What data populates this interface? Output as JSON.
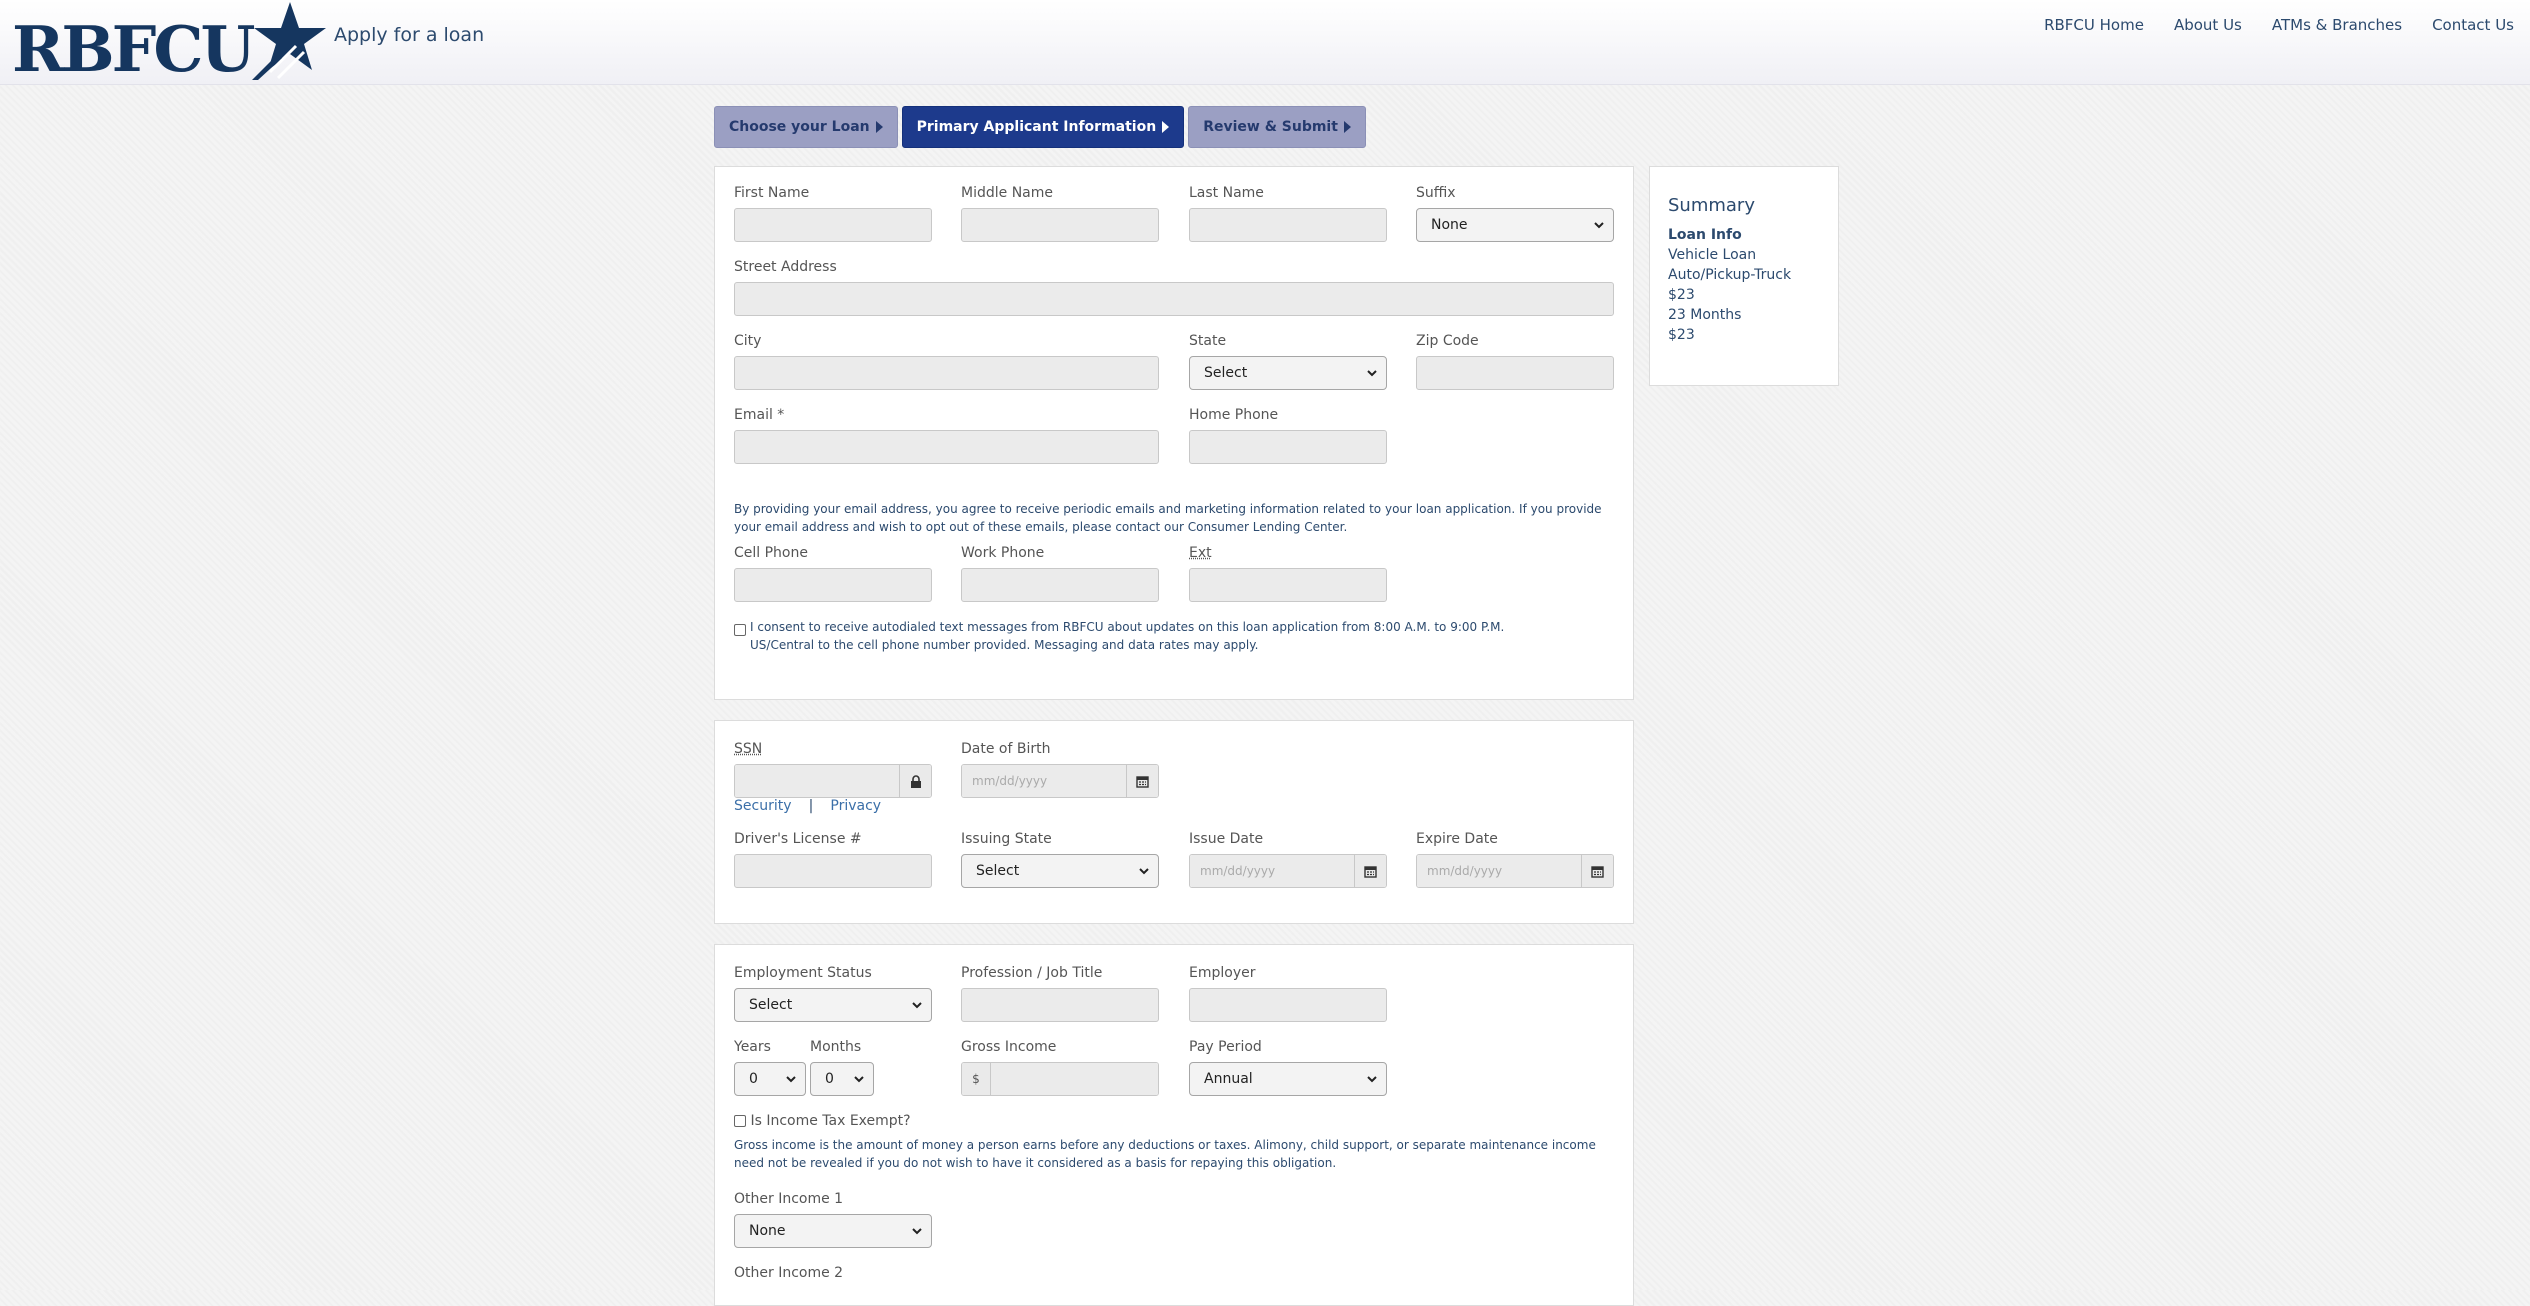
{
  "header": {
    "logo_text": "RBFCU",
    "title": "Apply for a loan",
    "nav": [
      "RBFCU Home",
      "About Us",
      "ATMs & Branches",
      "Contact Us"
    ]
  },
  "steps": [
    "Choose your Loan",
    "Primary Applicant Information",
    "Review & Submit"
  ],
  "personal": {
    "first_name_label": "First Name",
    "middle_name_label": "Middle Name",
    "last_name_label": "Last Name",
    "suffix_label": "Suffix",
    "suffix_value": "None",
    "street_label": "Street Address",
    "city_label": "City",
    "state_label": "State",
    "state_value": "Select",
    "zip_label": "Zip Code",
    "email_label": "Email *",
    "home_phone_label": "Home Phone",
    "email_notice": "By providing your email address, you agree to receive periodic emails and marketing information related to your loan application. If you provide your email address and wish to opt out of these emails, please contact our Consumer Lending Center.",
    "cell_phone_label": "Cell Phone",
    "work_phone_label": "Work Phone",
    "ext_label": "Ext",
    "sms_consent": "I consent to receive autodialed text messages from RBFCU about updates on this loan application from 8:00 A.M. to 9:00 P.M. US/Central to the cell phone number provided. Messaging and data rates may apply."
  },
  "identity": {
    "ssn_label": "SSN",
    "dob_label": "Date of Birth",
    "date_placeholder": "mm/dd/yyyy",
    "security_link": "Security",
    "separator": "|",
    "privacy_link": "Privacy",
    "license_label": "Driver's License #",
    "issuing_state_label": "Issuing State",
    "issuing_state_value": "Select",
    "issue_date_label": "Issue Date",
    "expire_date_label": "Expire Date"
  },
  "employment": {
    "status_label": "Employment Status",
    "status_value": "Select",
    "profession_label": "Profession / Job Title",
    "employer_label": "Employer",
    "years_label": "Years",
    "years_value": "0",
    "months_label": "Months",
    "months_value": "0",
    "gross_income_label": "Gross Income",
    "currency_symbol": "$",
    "pay_period_label": "Pay Period",
    "pay_period_value": "Annual",
    "tax_exempt_label": "Is Income Tax Exempt?",
    "gross_income_note": "Gross income is the amount of money a person earns before any deductions or taxes. Alimony, child support, or separate maintenance income need not be revealed if you do not wish to have it considered as a basis for repaying this obligation.",
    "other_income_1_label": "Other Income 1",
    "other_income_1_value": "None",
    "other_income_2_label": "Other Income 2"
  },
  "summary": {
    "title": "Summary",
    "subtitle": "Loan Info",
    "lines": [
      "Vehicle Loan",
      "Auto/Pickup-Truck",
      "$23",
      "23 Months",
      "$23"
    ]
  },
  "colors": {
    "brand_navy": "#15365f",
    "active_step": "#1d3a8c",
    "inactive_step": "#9b9fc3"
  }
}
